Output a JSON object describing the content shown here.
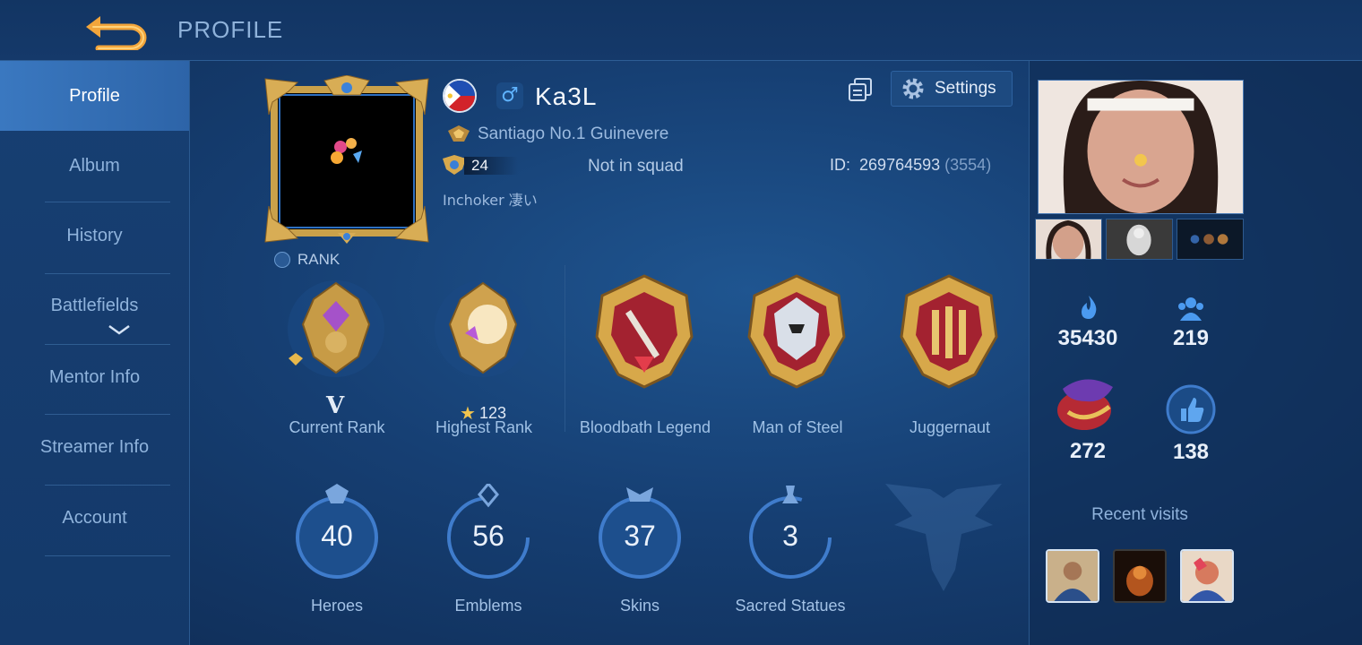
{
  "header": {
    "title": "PROFILE",
    "back_icon": "back-arrow-icon"
  },
  "sidebar": {
    "items": [
      {
        "label": "Profile",
        "active": true
      },
      {
        "label": "Album",
        "active": false
      },
      {
        "label": "History",
        "active": false
      },
      {
        "label": "Battlefields",
        "active": false
      },
      {
        "label": "Mentor Info",
        "active": false
      },
      {
        "label": "Streamer Info",
        "active": false
      },
      {
        "label": "Account",
        "active": false
      }
    ]
  },
  "profile": {
    "name": "Ka3L",
    "gender_symbol": "♂",
    "title": "Santiago No.1 Guinevere",
    "level": "24",
    "squad_status": "Not in squad",
    "id_label": "ID:",
    "id_value": "269764593",
    "server": "(3554)",
    "motto": "Inchoker 凄い",
    "rank_label": "RANK",
    "settings_label": "Settings",
    "flag": "philippines-flag",
    "colors": {
      "accent_gold": "#d9a640",
      "bg": "#163f73",
      "active_tab": "#3a78c0"
    }
  },
  "badges": [
    {
      "label": "Current Rank",
      "sub": "V"
    },
    {
      "label": "Highest Rank",
      "sub": "123"
    },
    {
      "label": "Bloodbath Legend"
    },
    {
      "label": "Man of Steel"
    },
    {
      "label": "Juggernaut"
    }
  ],
  "stats": [
    {
      "value": "40",
      "label": "Heroes"
    },
    {
      "value": "56",
      "label": "Emblems"
    },
    {
      "value": "37",
      "label": "Skins"
    },
    {
      "value": "3",
      "label": "Sacred Statues"
    }
  ],
  "right": {
    "popularity": "35430",
    "followers": "219",
    "charm": "272",
    "likes": "138",
    "recent_visits_label": "Recent visits"
  }
}
